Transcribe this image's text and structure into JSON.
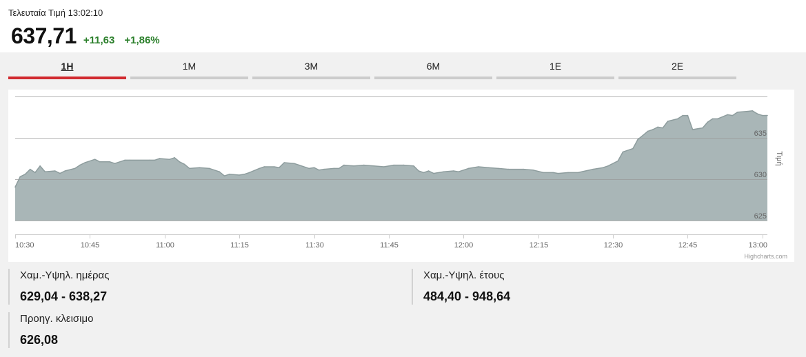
{
  "header": {
    "last_price_label": "Τελευταία Τιμή",
    "last_update_time": "13:02:10",
    "price": "637,71",
    "change": "+11,63",
    "change_percent": "+1,86%"
  },
  "colors": {
    "positive": "#2a7f2a",
    "active_tab": "#d12a2f",
    "inactive_tab": "#cccccc",
    "area_fill": "#a9b6b7",
    "area_line": "#8e9d9e"
  },
  "tabs": [
    {
      "label": "1H",
      "active": true
    },
    {
      "label": "1M",
      "active": false
    },
    {
      "label": "3M",
      "active": false
    },
    {
      "label": "6M",
      "active": false
    },
    {
      "label": "1E",
      "active": false
    },
    {
      "label": "2E",
      "active": false
    }
  ],
  "chart": {
    "credit": "Highcharts.com"
  },
  "chart_data": {
    "type": "area",
    "ylabel": "Τιμή",
    "y_axis_side": "right",
    "xlim": [
      "10:30",
      "13:01"
    ],
    "ylim": [
      625,
      640
    ],
    "x_ticks": [
      "10:30",
      "10:45",
      "11:00",
      "11:15",
      "11:30",
      "11:45",
      "12:00",
      "12:15",
      "12:30",
      "12:45",
      "13:00"
    ],
    "y_ticks": [
      625,
      630,
      635
    ],
    "grid": true,
    "x": [
      "10:30",
      "10:31",
      "10:32",
      "10:33",
      "10:34",
      "10:35",
      "10:36",
      "10:38",
      "10:39",
      "10:40",
      "10:42",
      "10:43",
      "10:44",
      "10:46",
      "10:47",
      "10:49",
      "10:50",
      "10:52",
      "10:53",
      "10:57",
      "10:58",
      "10:59",
      "11:01",
      "11:02",
      "11:03",
      "11:04",
      "11:05",
      "11:07",
      "11:09",
      "11:11",
      "11:12",
      "11:13",
      "11:15",
      "11:16",
      "11:17",
      "11:19",
      "11:20",
      "11:22",
      "11:23",
      "11:24",
      "11:26",
      "11:27",
      "11:29",
      "11:30",
      "11:31",
      "11:32",
      "11:34",
      "11:35",
      "11:36",
      "11:38",
      "11:40",
      "11:42",
      "11:44",
      "11:46",
      "11:48",
      "11:50",
      "11:51",
      "11:52",
      "11:53",
      "11:54",
      "11:56",
      "11:58",
      "11:59",
      "12:01",
      "12:03",
      "12:05",
      "12:07",
      "12:09",
      "12:12",
      "12:14",
      "12:16",
      "12:18",
      "12:19",
      "12:21",
      "12:23",
      "12:26",
      "12:28",
      "12:29",
      "12:31",
      "12:32",
      "12:34",
      "12:35",
      "12:37",
      "12:38",
      "12:39",
      "12:40",
      "12:41",
      "12:43",
      "12:44",
      "12:45",
      "12:46",
      "12:48",
      "12:49",
      "12:50",
      "12:51",
      "12:53",
      "12:54",
      "12:55",
      "12:57",
      "12:58",
      "12:59",
      "13:00",
      "13:01"
    ],
    "series": [
      {
        "values": [
          629.04,
          630.3,
          630.6,
          631.2,
          630.8,
          631.6,
          630.9,
          631.0,
          630.7,
          631.0,
          631.3,
          631.7,
          632.0,
          632.4,
          632.1,
          632.1,
          631.9,
          632.3,
          632.3,
          632.3,
          632.3,
          632.5,
          632.4,
          632.6,
          632.1,
          631.8,
          631.3,
          631.4,
          631.3,
          630.9,
          630.4,
          630.6,
          630.5,
          630.6,
          630.8,
          631.3,
          631.5,
          631.5,
          631.4,
          632.0,
          631.9,
          631.7,
          631.3,
          631.4,
          631.1,
          631.2,
          631.3,
          631.3,
          631.7,
          631.6,
          631.7,
          631.6,
          631.5,
          631.7,
          631.7,
          631.6,
          631.0,
          630.8,
          631.0,
          630.7,
          630.9,
          631.0,
          630.9,
          631.3,
          631.5,
          631.4,
          631.3,
          631.2,
          631.2,
          631.1,
          630.8,
          630.8,
          630.7,
          630.8,
          630.8,
          631.2,
          631.4,
          631.6,
          632.2,
          633.3,
          633.7,
          634.8,
          635.8,
          636.0,
          636.3,
          636.2,
          637.0,
          637.3,
          637.7,
          637.7,
          636.0,
          636.2,
          636.9,
          637.3,
          637.3,
          637.8,
          637.7,
          638.1,
          638.2,
          638.27,
          637.9,
          637.7,
          637.71
        ]
      }
    ]
  },
  "stats": {
    "day_range": {
      "label": "Χαμ.-Υψηλ. ημέρας",
      "value": "629,04 - 638,27"
    },
    "year_range": {
      "label": "Χαμ.-Υψηλ. έτους",
      "value": "484,40 - 948,64"
    },
    "previous_close": {
      "label": "Προηγ. κλεισιμο",
      "value": "626,08"
    }
  }
}
